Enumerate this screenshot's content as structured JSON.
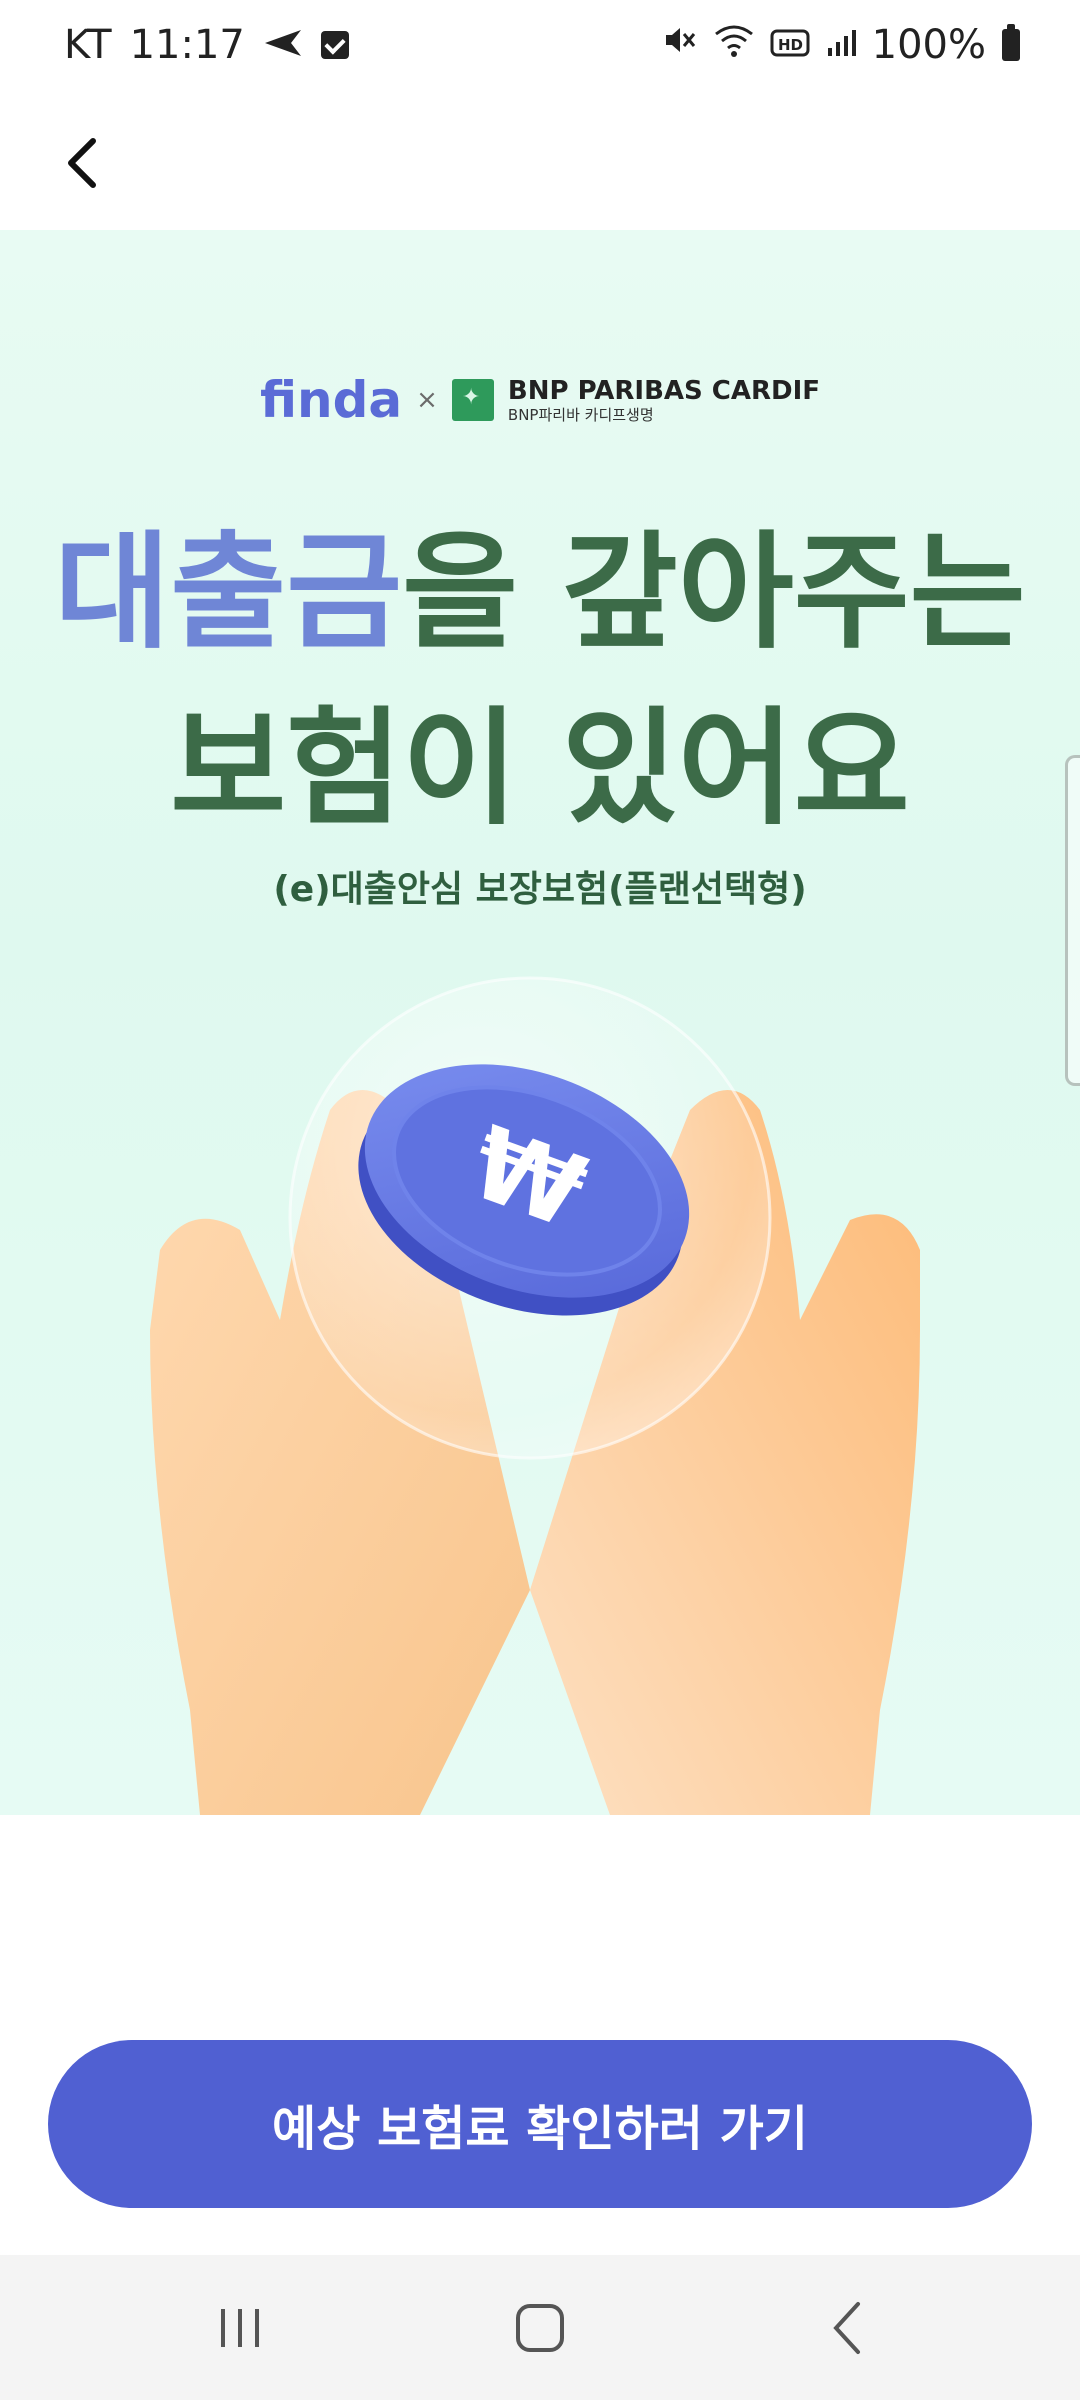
{
  "status_bar": {
    "carrier": "KT",
    "time": "11:17",
    "battery": "100%",
    "icons": [
      "send-icon",
      "checkbox-icon",
      "mute-icon",
      "wifi-icon",
      "hd-icon",
      "signal-icon",
      "battery-icon"
    ]
  },
  "header": {
    "back_icon": "back-arrow-icon"
  },
  "brand": {
    "finda": "finda",
    "times": "×",
    "partner_name": "BNP PARIBAS CARDIF",
    "partner_sub": "BNP파리바 카디프생명"
  },
  "headline": {
    "line1_highlight": "대출금",
    "line1_rest": "을 갚아주는",
    "line2": "보험이 있어요"
  },
  "subtitle": "(e)대출안심 보장보험(플랜선택형)",
  "cta": {
    "label": "예상 보험료 확인하러 가기"
  },
  "nav": {
    "icons": [
      "recent-apps-icon",
      "home-icon",
      "back-icon"
    ]
  },
  "colors": {
    "accent": "#5060d2",
    "headline_green": "#3c6b48",
    "headline_blue": "#6f86d6",
    "hero_bg": "#e3faf1"
  }
}
